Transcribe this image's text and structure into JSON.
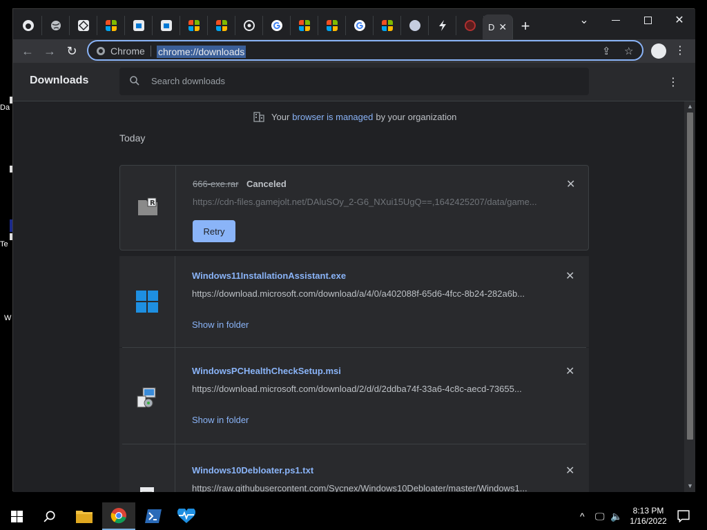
{
  "desktop": {
    "icons": [
      "Da",
      "Te",
      "W"
    ]
  },
  "window": {
    "tabs_active_letter": "D",
    "new_tab_symbol": "+",
    "controls": {
      "minimize": "—",
      "maximize": "☐",
      "close": "✕",
      "tab_search": "⌄"
    }
  },
  "toolbar": {
    "omnibox_chip": "Chrome",
    "url": "chrome://downloads"
  },
  "downloads": {
    "title": "Downloads",
    "search_placeholder": "Search downloads",
    "managed_prefix": "Your",
    "managed_link": "browser is managed",
    "managed_suffix": "by your organization",
    "section_label": "Today",
    "items": [
      {
        "filename": "666-exe.rar",
        "status": "Canceled",
        "url": "https://cdn-files.gamejolt.net/DAluSOy_2-G6_NXui15UgQ==,1642425207/data/game...",
        "action": "Retry"
      },
      {
        "filename": "Windows11InstallationAssistant.exe",
        "url": "https://download.microsoft.com/download/a/4/0/a402088f-65d6-4fcc-8b24-282a6b...",
        "action": "Show in folder"
      },
      {
        "filename": "WindowsPCHealthCheckSetup.msi",
        "url": "https://download.microsoft.com/download/2/d/d/2ddba74f-33a6-4c8c-aecd-73655...",
        "action": "Show in folder"
      },
      {
        "filename": "Windows10Debloater.ps1.txt",
        "url": "https://raw.githubusercontent.com/Sycnex/Windows10Debloater/master/Windows1..."
      }
    ]
  },
  "taskbar": {
    "time": "8:13 PM",
    "date": "1/16/2022"
  }
}
